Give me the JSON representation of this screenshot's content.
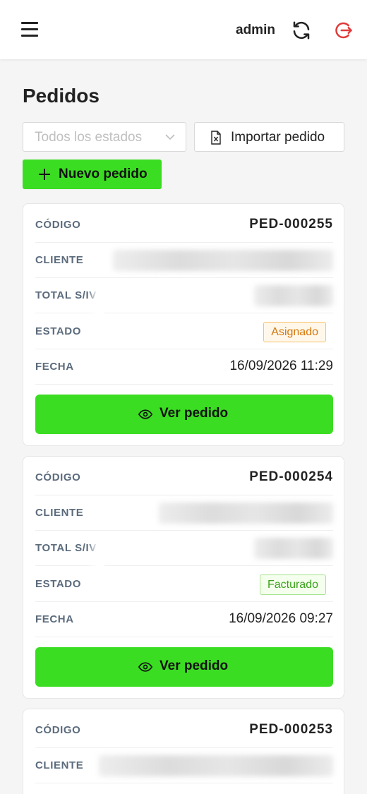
{
  "header": {
    "menu_icon": "hamburger-menu-icon",
    "user": "admin",
    "refresh_icon": "refresh-icon",
    "logout_icon": "logout-icon",
    "logout_color": "#e23a3a"
  },
  "page": {
    "title": "Pedidos"
  },
  "filters": {
    "status_placeholder": "Todos los estados",
    "import_label": "Importar pedido",
    "new_label": "Nuevo pedido"
  },
  "labels": {
    "code": "CÓDIGO",
    "client": "CLIENTE",
    "total": "TOTAL S/IV",
    "status": "ESTADO",
    "date": "FECHA",
    "view": "Ver pedido"
  },
  "colors": {
    "accent": "#3bdd22",
    "asignado": "#d4760a",
    "facturado": "#3aa11a"
  },
  "orders": [
    {
      "code": "PED-000255",
      "status": "Asignado",
      "date": "16/09/2026 11:29"
    },
    {
      "code": "PED-000254",
      "status": "Facturado",
      "date": "16/09/2026 09:27"
    },
    {
      "code": "PED-000253"
    }
  ]
}
